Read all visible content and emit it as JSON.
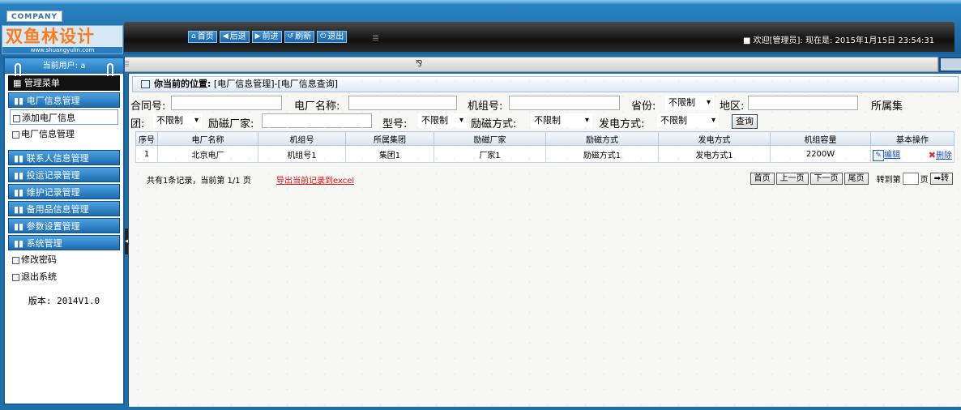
{
  "header": {
    "company": "COMPANY",
    "logo_text": "双鱼林设计",
    "logo_url": "www.shuangyulin.com",
    "nav": [
      {
        "icon": "home-icon",
        "glyph": "⌂",
        "label": "首页"
      },
      {
        "icon": "back-icon",
        "glyph": "◀",
        "label": "后退"
      },
      {
        "icon": "forward-icon",
        "glyph": "▶",
        "label": "前进"
      },
      {
        "icon": "refresh-icon",
        "glyph": "↺",
        "label": "刷新"
      },
      {
        "icon": "power-icon",
        "glyph": "⏻",
        "label": "退出"
      }
    ],
    "welcome": "■ 欢迎[管理员]: 现在是: 2015年1月15日 23:54:31"
  },
  "toggle_glyph": "⅋",
  "sidebar": {
    "current_user": "当前用户: a",
    "menu_title": "管理菜单",
    "sections": [
      {
        "label": "电厂信息管理",
        "items": [
          "添加电厂信息",
          "电厂信息管理"
        ]
      },
      {
        "label": "联系人信息管理",
        "items": []
      },
      {
        "label": "投运记录管理",
        "items": []
      },
      {
        "label": "维护记录管理",
        "items": []
      },
      {
        "label": "备用品信息管理",
        "items": []
      },
      {
        "label": "参数设置管理",
        "items": []
      },
      {
        "label": "系统管理",
        "items": [
          "修改密码",
          "退出系统"
        ]
      }
    ],
    "version": "版本: 2014V1.0"
  },
  "location": {
    "label": "你当前的位置:",
    "path": "[电厂信息管理]-[电厂信息查询]"
  },
  "filters": {
    "contract_no": "合同号:",
    "plant_name": "电厂名称:",
    "unit_no": "机组号:",
    "province": "省份:",
    "province_value": "不限制",
    "region": "地区:",
    "group_a": "所属集",
    "group_b": "团:",
    "group_value": "不限制",
    "exciter_maker": "励磁厂家:",
    "model": "型号:",
    "model_value": "不限制",
    "exc_mode": "励磁方式:",
    "exc_mode_value": "不限制",
    "gen_mode": "发电方式:",
    "gen_mode_value": "不限制",
    "query_button": "查询"
  },
  "table": {
    "headers": [
      "序号",
      "电厂名称",
      "机组号",
      "所属集团",
      "励磁厂家",
      "励磁方式",
      "发电方式",
      "机组容量",
      "基本操作"
    ],
    "rows": [
      {
        "cells": [
          "1",
          "北京电厂",
          "机组号1",
          "集团1",
          "厂家1",
          "励磁方式1",
          "发电方式1",
          "2200W"
        ],
        "edit": "编辑",
        "delete": "删除"
      }
    ]
  },
  "footer": {
    "info": "共有1条记录，当前第 1/1 页",
    "export": "导出当前记录到excel",
    "first": "首页",
    "prev": "上一页",
    "next": "下一页",
    "last": "尾页",
    "goto": "转到第",
    "page": "页",
    "go": "➡转"
  }
}
